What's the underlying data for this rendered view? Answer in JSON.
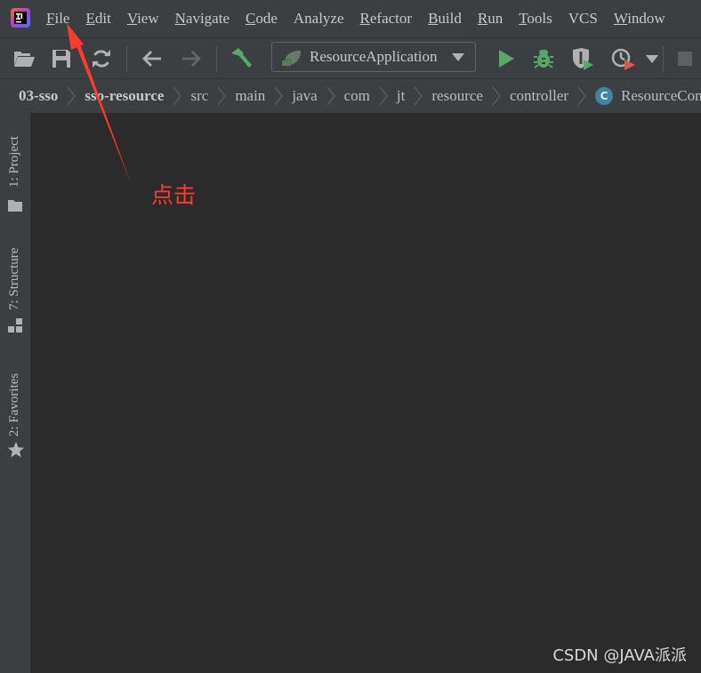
{
  "menu": {
    "items": [
      {
        "mnemonic": "F",
        "rest": "ile"
      },
      {
        "mnemonic": "E",
        "rest": "dit"
      },
      {
        "mnemonic": "V",
        "rest": "iew"
      },
      {
        "mnemonic": "N",
        "rest": "avigate"
      },
      {
        "mnemonic": "C",
        "rest": "ode"
      },
      {
        "mnemonic": "",
        "rest": "Analyze"
      },
      {
        "mnemonic": "R",
        "rest": "efactor"
      },
      {
        "mnemonic": "B",
        "rest": "uild"
      },
      {
        "mnemonic": "R",
        "rest": "un"
      },
      {
        "mnemonic": "T",
        "rest": "ools"
      },
      {
        "mnemonic": "",
        "rest": "VCS"
      },
      {
        "mnemonic": "W",
        "rest": "indow"
      }
    ]
  },
  "toolbar": {
    "run_config": "ResourceApplication",
    "icons": [
      "open-folder-icon",
      "save-icon",
      "sync-icon",
      "back-arrow-icon",
      "forward-arrow-icon",
      "build-hammer-icon",
      "run-icon",
      "debug-icon",
      "coverage-icon",
      "profile-icon",
      "stop-icon"
    ],
    "colors": {
      "run": "#59a869",
      "debug": "#59a869",
      "hammer": "#59a869",
      "profile_badge": "#e05555"
    }
  },
  "breadcrumb": {
    "items": [
      "03-sso",
      "sso-resource",
      "src",
      "main",
      "java",
      "com",
      "jt",
      "resource",
      "controller"
    ],
    "class_badge": "C",
    "class_name": "ResourceController"
  },
  "side_tabs": {
    "project": "1: Project",
    "structure": "7: Structure",
    "favorites": "2: Favorites"
  },
  "annotation": {
    "text": "点击",
    "color": "#ff3b30"
  },
  "watermark": "CSDN @JAVA派派"
}
